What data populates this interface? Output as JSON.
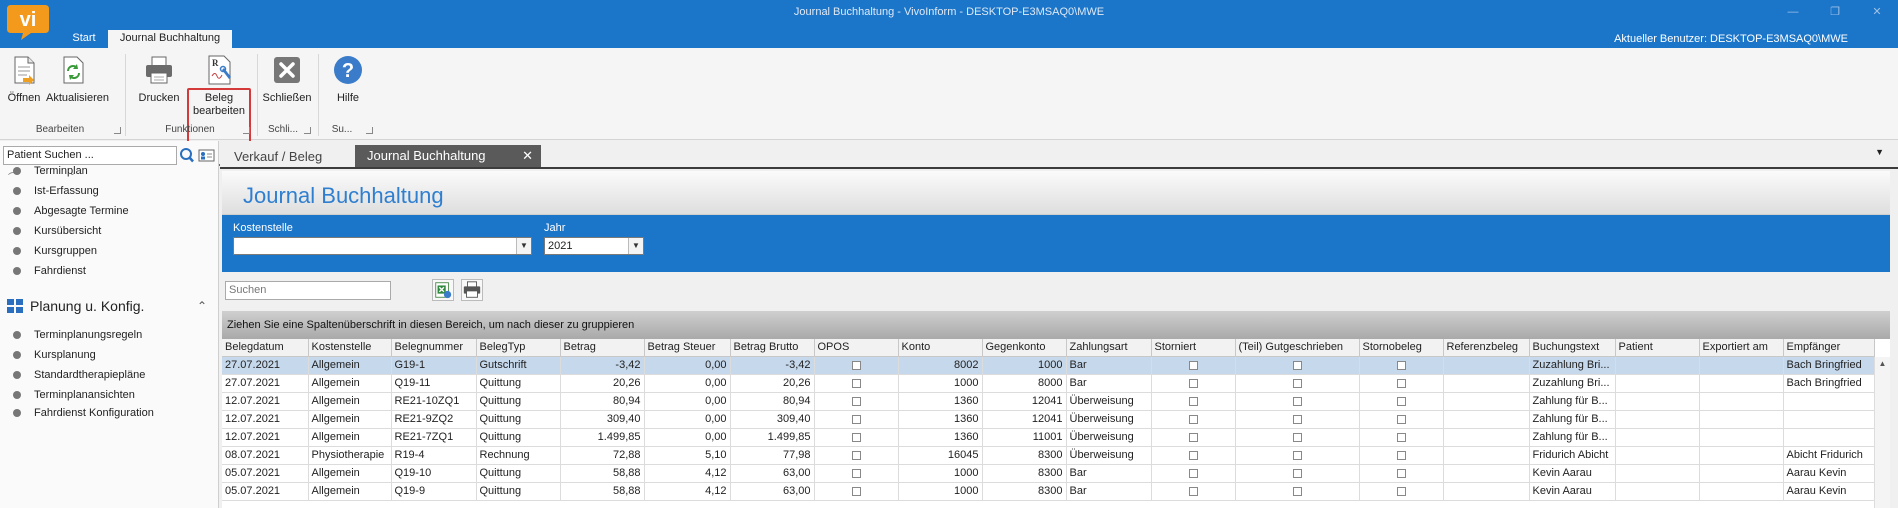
{
  "window": {
    "title": "Journal Buchhaltung - VivoInform - DESKTOP-E3MSAQ0\\MWE",
    "controls": [
      "—",
      "❐",
      "✕"
    ]
  },
  "app": {
    "logo_text": "vi",
    "current_user": "Aktueller Benutzer: DESKTOP-E3MSAQ0\\MWE"
  },
  "ribbon_tabs": [
    {
      "label": "Start"
    },
    {
      "label": "Journal Buchhaltung"
    }
  ],
  "ribbon": {
    "buttons": {
      "open": "Öffnen",
      "refresh": "Aktualisieren",
      "print": "Drucken",
      "edit_line1": "Beleg",
      "edit_line2": "bearbeiten",
      "close": "Schließen",
      "help": "Hilfe"
    },
    "groups": {
      "bearbeiten": "Bearbeiten",
      "funktionen": "Funktionen",
      "schliessen": "Schli...",
      "support": "Su..."
    }
  },
  "sidebar": {
    "search_value": "Patient Suchen ...",
    "items_top": [
      "Terminplan",
      "Ist-Erfassung",
      "Abgesagte Termine",
      "Kursübersicht",
      "Kursgruppen",
      "Fahrdienst"
    ],
    "group_title": "Planung u. Konfig.",
    "items_bottom": [
      "Terminplanungsregeln",
      "Kursplanung",
      "Standardtherapiepläne",
      "Terminplanansichten",
      "Fahrdienst Konfiguration"
    ]
  },
  "doc_tabs": [
    {
      "label": "Verkauf / Beleg"
    },
    {
      "label": "Journal Buchhaltung"
    }
  ],
  "journal": {
    "title": "Journal Buchhaltung",
    "filters": {
      "kostenstelle_label": "Kostenstelle",
      "kostenstelle_value": "",
      "jahr_label": "Jahr",
      "jahr_value": "2021"
    },
    "search_placeholder": "Suchen",
    "group_hint": "Ziehen Sie eine Spaltenüberschrift in diesen Bereich, um nach dieser zu gruppieren"
  },
  "grid": {
    "columns": [
      "Belegdatum",
      "Kostenstelle",
      "Belegnummer",
      "BelegTyp",
      "Betrag",
      "Betrag Steuer",
      "Betrag Brutto",
      "OPOS",
      "Konto",
      "Gegenkonto",
      "Zahlungsart",
      "Storniert",
      "(Teil) Gutgeschrieben",
      "Stornobeleg",
      "Referenzbeleg",
      "Buchungstext",
      "Patient",
      "Exportiert am",
      "Empfänger"
    ],
    "rows": [
      [
        "27.07.2021",
        "Allgemein",
        "G19-1",
        "Gutschrift",
        "-3,42",
        "0,00",
        "-3,42",
        "",
        "8002",
        "1000",
        "Bar",
        "",
        "",
        "",
        "",
        "Zuzahlung Bri...",
        "",
        "",
        "Bach Bringfried"
      ],
      [
        "27.07.2021",
        "Allgemein",
        "Q19-11",
        "Quittung",
        "20,26",
        "0,00",
        "20,26",
        "",
        "1000",
        "8000",
        "Bar",
        "",
        "",
        "",
        "",
        "Zuzahlung Bri...",
        "",
        "",
        "Bach Bringfried"
      ],
      [
        "12.07.2021",
        "Allgemein",
        "RE21-10ZQ1",
        "Quittung",
        "80,94",
        "0,00",
        "80,94",
        "",
        "1360",
        "12041",
        "Überweisung",
        "",
        "",
        "",
        "",
        "Zahlung für B...",
        "",
        "",
        ""
      ],
      [
        "12.07.2021",
        "Allgemein",
        "RE21-9ZQ2",
        "Quittung",
        "309,40",
        "0,00",
        "309,40",
        "",
        "1360",
        "12041",
        "Überweisung",
        "",
        "",
        "",
        "",
        "Zahlung für B...",
        "",
        "",
        ""
      ],
      [
        "12.07.2021",
        "Allgemein",
        "RE21-7ZQ1",
        "Quittung",
        "1.499,85",
        "0,00",
        "1.499,85",
        "",
        "1360",
        "11001",
        "Überweisung",
        "",
        "",
        "",
        "",
        "Zahlung für B...",
        "",
        "",
        ""
      ],
      [
        "08.07.2021",
        "Physiotherapie",
        "R19-4",
        "Rechnung",
        "72,88",
        "5,10",
        "77,98",
        "",
        "16045",
        "8300",
        "Überweisung",
        "",
        "",
        "",
        "",
        "Fridurich Abicht",
        "",
        "",
        "Abicht Fridurich"
      ],
      [
        "05.07.2021",
        "Allgemein",
        "Q19-10",
        "Quittung",
        "58,88",
        "4,12",
        "63,00",
        "",
        "1000",
        "8300",
        "Bar",
        "",
        "",
        "",
        "",
        "Kevin Aarau",
        "",
        "",
        "Aarau Kevin"
      ],
      [
        "05.07.2021",
        "Allgemein",
        "Q19-9",
        "Quittung",
        "58,88",
        "4,12",
        "63,00",
        "",
        "1000",
        "8300",
        "Bar",
        "",
        "",
        "",
        "",
        "Kevin Aarau",
        "",
        "",
        "Aarau Kevin"
      ]
    ]
  },
  "colors": {
    "brand_blue": "#1b75c9",
    "title_blue": "#2f7fd0",
    "logo_orange": "#f39a1c",
    "highlight_red": "#d43a3a",
    "selected_row": "#c6d8ec"
  }
}
